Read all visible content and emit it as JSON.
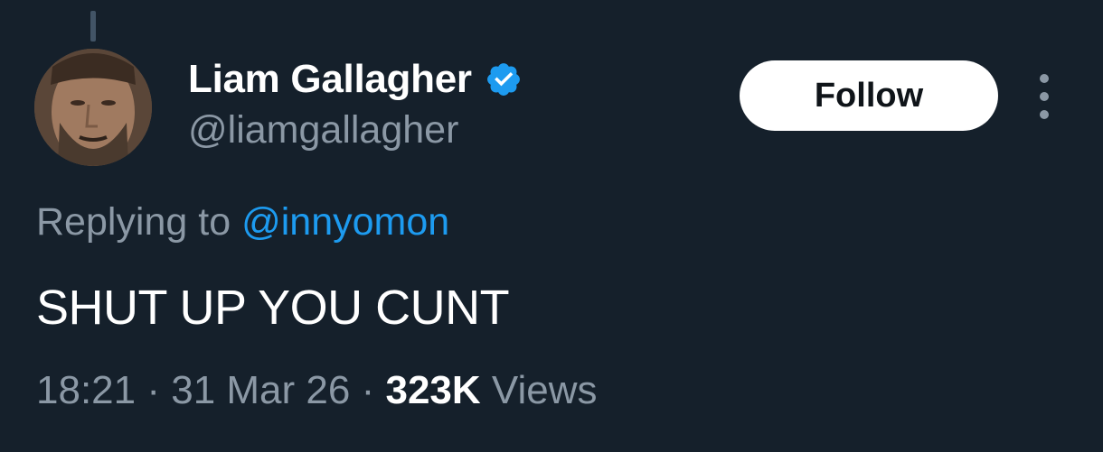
{
  "author": {
    "display_name": "Liam Gallagher",
    "handle": "@liamgallagher",
    "verified": true
  },
  "follow_button": {
    "label": "Follow"
  },
  "more_menu": {
    "icon": "more-vertical-icon"
  },
  "reply_context": {
    "prefix": "Replying to",
    "mention": "@innyomon"
  },
  "tweet": {
    "text": "SHUT UP YOU CUNT",
    "time": "18:21",
    "separator": "·",
    "date": "31 Mar 26",
    "views_count": "323K",
    "views_label": "Views"
  },
  "colors": {
    "background": "#15202b",
    "primary_text": "#ffffff",
    "secondary_text": "#8b98a5",
    "accent": "#1d9bf0"
  }
}
